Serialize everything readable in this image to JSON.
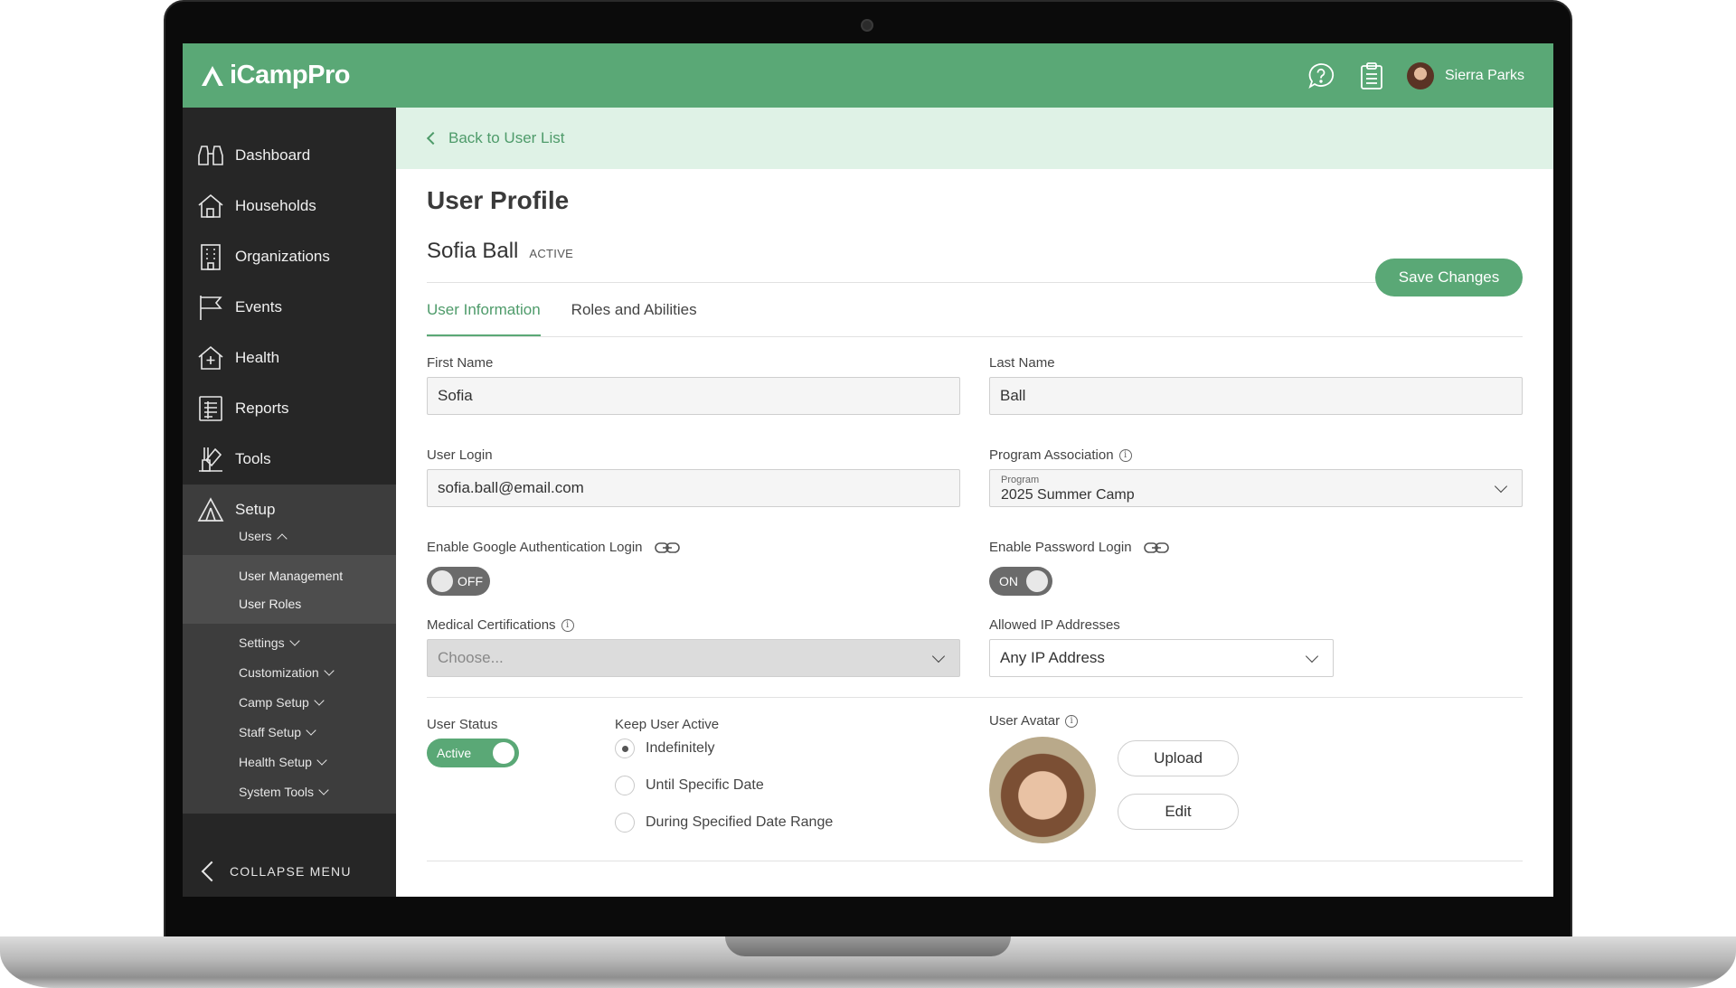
{
  "brand": {
    "name": "iCampPro",
    "accent": "#5aa876",
    "sidebar_bg": "#262626"
  },
  "topbar": {
    "user_name": "Sierra Parks"
  },
  "sidebar": {
    "items": [
      {
        "label": "Dashboard",
        "icon": "binoculars-icon"
      },
      {
        "label": "Households",
        "icon": "house-icon"
      },
      {
        "label": "Organizations",
        "icon": "building-icon"
      },
      {
        "label": "Events",
        "icon": "flag-icon"
      },
      {
        "label": "Health",
        "icon": "health-house-icon"
      },
      {
        "label": "Reports",
        "icon": "report-icon"
      },
      {
        "label": "Tools",
        "icon": "tools-icon"
      }
    ],
    "setup": {
      "label": "Setup",
      "users_toggle": "Users",
      "users_links": [
        "User Management",
        "User Roles"
      ],
      "groups": [
        "Settings",
        "Customization",
        "Camp Setup",
        "Staff Setup",
        "Health Setup",
        "System Tools"
      ]
    },
    "collapse_label": "COLLAPSE MENU"
  },
  "main": {
    "back_link": "Back to User List",
    "page_title": "User Profile",
    "person_name": "Sofia Ball",
    "status_tag": "ACTIVE",
    "save_label": "Save Changes",
    "tabs": [
      "User Information",
      "Roles and Abilities"
    ],
    "form": {
      "first_name_label": "First Name",
      "first_name_value": "Sofia",
      "last_name_label": "Last Name",
      "last_name_value": "Ball",
      "user_login_label": "User Login",
      "user_login_value": "sofia.ball@email.com",
      "program_assoc_label": "Program Association",
      "program_small_label": "Program",
      "program_value": "2025 Summer Camp",
      "google_auth_label": "Enable Google Authentication Login",
      "google_auth_state": "OFF",
      "password_login_label": "Enable Password Login",
      "password_login_state": "ON",
      "medical_label": "Medical Certifications",
      "medical_placeholder": "Choose...",
      "allowed_ip_label": "Allowed IP Addresses",
      "allowed_ip_value": "Any IP Address",
      "user_status_label": "User Status",
      "user_status_state": "Active",
      "keep_active_label": "Keep User Active",
      "keep_active_options": [
        "Indefinitely",
        "Until Specific Date",
        "During Specified Date Range"
      ],
      "keep_active_selected": 0,
      "avatar_label": "User Avatar",
      "upload_label": "Upload",
      "edit_label": "Edit"
    }
  }
}
